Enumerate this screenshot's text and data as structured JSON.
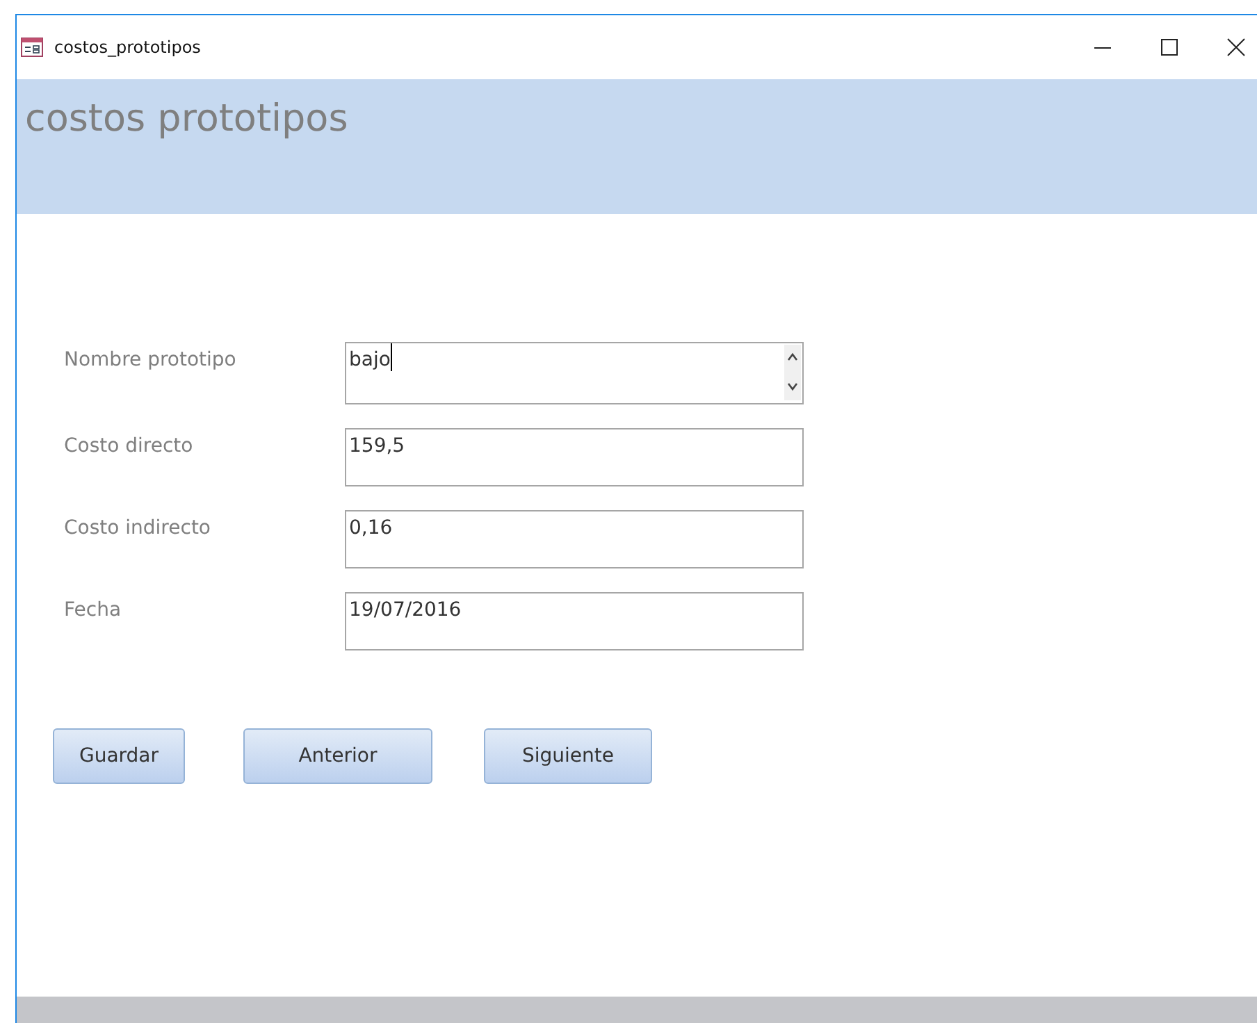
{
  "window": {
    "title": "costos_prototipos"
  },
  "header": {
    "title": "costos prototipos"
  },
  "fields": [
    {
      "label": "Nombre prototipo",
      "value": "bajo",
      "kind": "scroll",
      "focused": true
    },
    {
      "label": "Costo directo",
      "value": "159,5",
      "kind": "text",
      "focused": false
    },
    {
      "label": "Costo indirecto",
      "value": "0,16",
      "kind": "text",
      "focused": false
    },
    {
      "label": "Fecha",
      "value": "19/07/2016",
      "kind": "text",
      "focused": false
    }
  ],
  "buttons": [
    "Guardar",
    "Anterior",
    "Siguiente"
  ]
}
